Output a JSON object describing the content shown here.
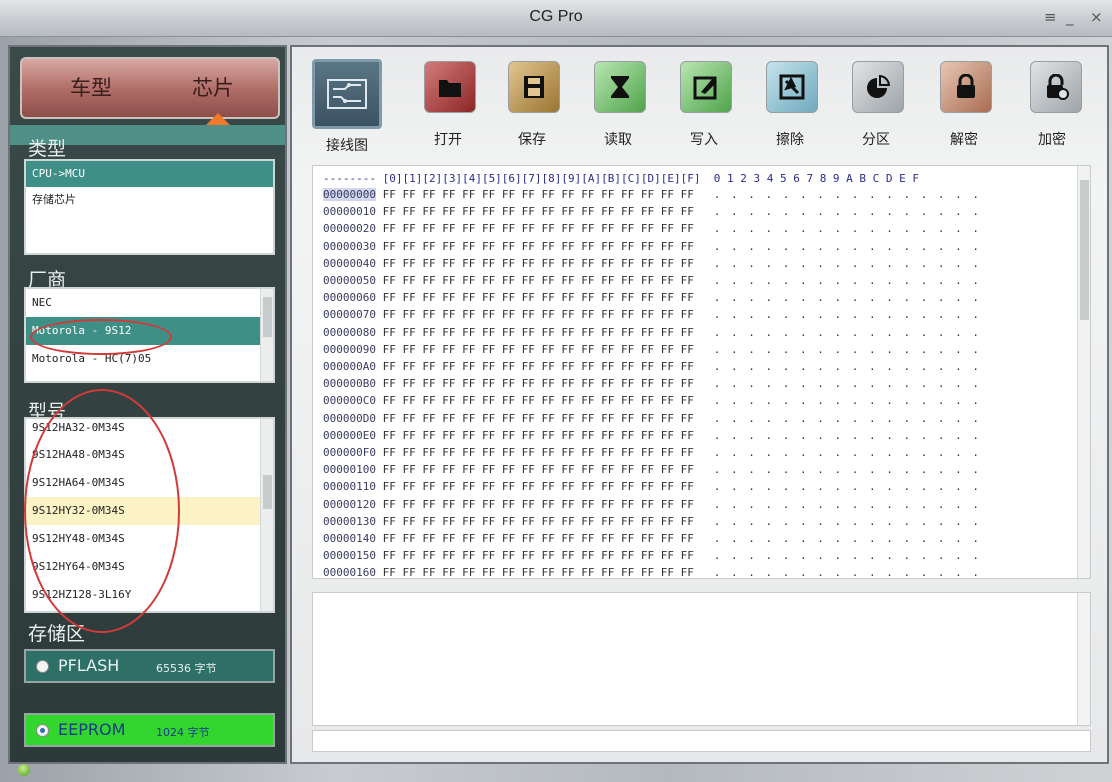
{
  "window": {
    "title": "CG Pro",
    "menu_icon": "≡",
    "minimize_icon": "_",
    "close_icon": "×"
  },
  "tabs": {
    "car": "车型",
    "chip": "芯片"
  },
  "sections": {
    "type": "类型",
    "vendor": "厂商",
    "model": "型号",
    "storage": "存储区"
  },
  "type_list": [
    "CPU->MCU",
    "存储芯片"
  ],
  "vendor_list": [
    "NEC",
    "Motorola - 9S12",
    "Motorola - HC(7)05"
  ],
  "model_list": [
    "9S12HA32-0M34S",
    "9S12HA48-0M34S",
    "9S12HA64-0M34S",
    "9S12HY32-0M34S",
    "9S12HY48-0M34S",
    "9S12HY64-0M34S",
    "9S12HZ128-3L16Y"
  ],
  "storage": [
    {
      "name": "PFLASH",
      "size": "65536 字节",
      "selected": false,
      "color": "#2e6f68"
    },
    {
      "name": "EEPROM",
      "size": "1024 字节",
      "selected": true,
      "color": "#33d52f"
    }
  ],
  "toolbar": [
    {
      "label": "接线图",
      "icon": "wiring-diagram-icon"
    },
    {
      "label": "打开",
      "icon": "folder-icon"
    },
    {
      "label": "保存",
      "icon": "floppy-disk-icon"
    },
    {
      "label": "读取",
      "icon": "hourglass-icon"
    },
    {
      "label": "写入",
      "icon": "pencil-box-icon"
    },
    {
      "label": "擦除",
      "icon": "eraser-icon"
    },
    {
      "label": "分区",
      "icon": "pie-chart-icon"
    },
    {
      "label": "解密",
      "icon": "lock-icon"
    },
    {
      "label": "加密",
      "icon": "lock-gear-icon"
    }
  ],
  "hex": {
    "header": "-------- [0][1][2][3][4][5][6][7][8][9][A][B][C][D][E][F]  0 1 2 3 4 5 6 7 8 9 A B C D E F",
    "bytes": "FF FF FF FF FF FF FF FF FF FF FF FF FF FF FF FF",
    "ascii": ". . . . . . . . . . . . . . . .",
    "rows": [
      "00000000",
      "00000010",
      "00000020",
      "00000030",
      "00000040",
      "00000050",
      "00000060",
      "00000070",
      "00000080",
      "00000090",
      "000000A0",
      "000000B0",
      "000000C0",
      "000000D0",
      "000000E0",
      "000000F0",
      "00000100",
      "00000110",
      "00000120",
      "00000130",
      "00000140",
      "00000150",
      "00000160"
    ]
  }
}
